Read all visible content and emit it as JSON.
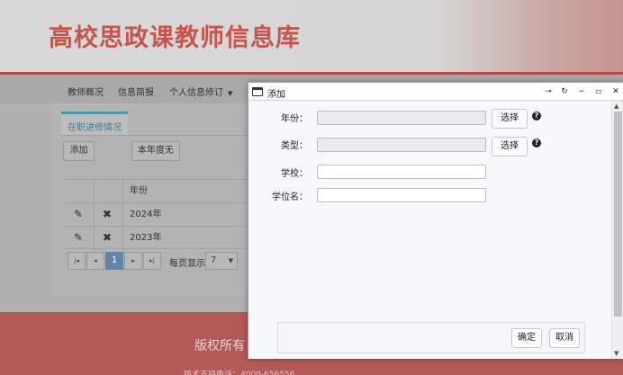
{
  "header": {
    "title": "高校思政课教师信息库"
  },
  "nav": {
    "items": [
      {
        "label": "教师概况"
      },
      {
        "label": "信息简报"
      },
      {
        "label": "个人信息修订"
      }
    ]
  },
  "content": {
    "tab_label": "在职进修情况",
    "add_button": "添加",
    "filter_button": "本年度无",
    "table": {
      "header": "年份",
      "rows": [
        {
          "year": "2024年"
        },
        {
          "year": "2023年"
        }
      ]
    },
    "pager": {
      "first": "|◂",
      "prev": "◂",
      "current": "1",
      "next": "▸",
      "last": "▸|",
      "per_page_label": "每页显示",
      "per_page_value": "7"
    }
  },
  "footer": {
    "text": "版权所有",
    "text2": "技术支持电话：4000-656556"
  },
  "dialog": {
    "title": "添加",
    "fields": [
      {
        "label": "年份：",
        "value": "",
        "button": "选择"
      },
      {
        "label": "类型：",
        "value": "",
        "button": "选择"
      },
      {
        "label": "学校：",
        "value": ""
      },
      {
        "label": "学位名：",
        "value": ""
      }
    ],
    "confirm": "确定",
    "cancel": "取消"
  },
  "colors": {
    "brand_red": "#c8554d",
    "tab_accent": "#4b9bb0",
    "pager_active": "#5f86a8"
  },
  "icons": [
    "edit-icon",
    "delete-icon",
    "window-icon",
    "pin-icon",
    "refresh-icon",
    "minimize-icon",
    "maximize-icon",
    "close-icon",
    "help-icon"
  ]
}
